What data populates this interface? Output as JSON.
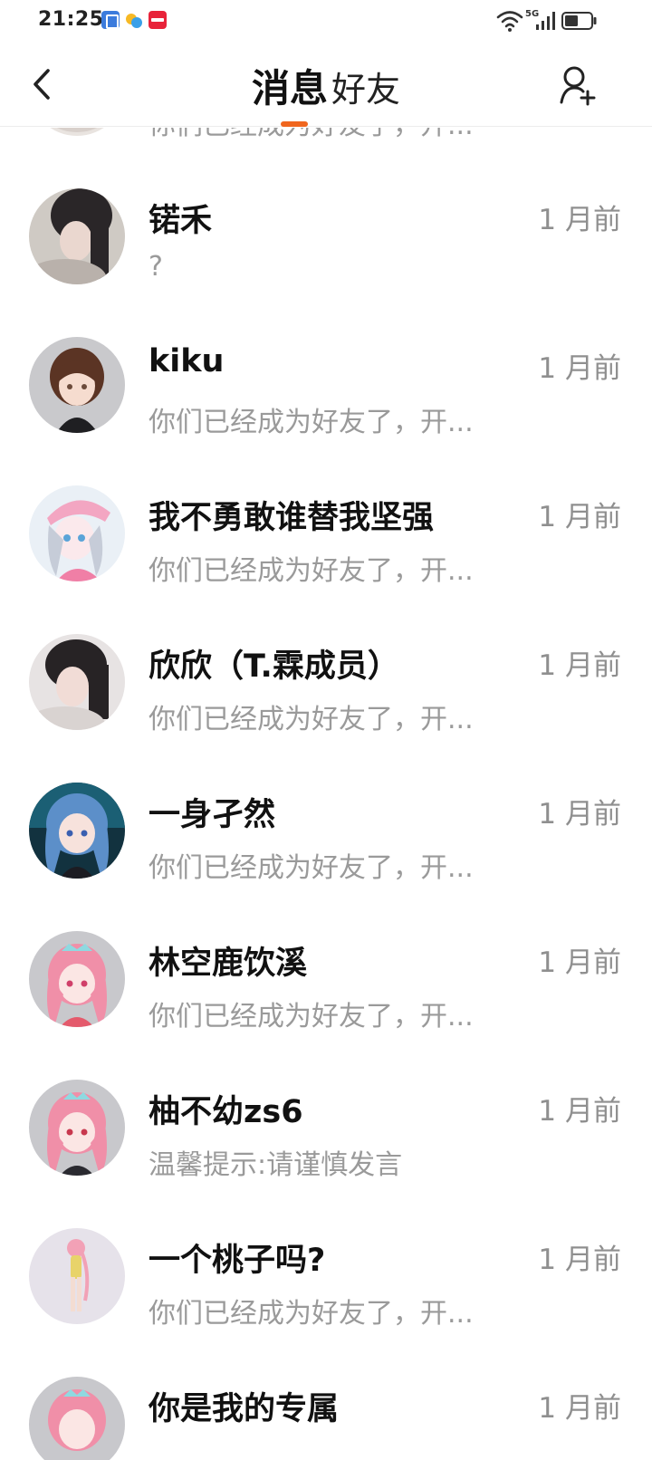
{
  "status_bar": {
    "time": "21:25",
    "network": "5G",
    "apps": [
      "contacts-app-icon",
      "weather-app-icon",
      "xiaohongshu-app-icon"
    ]
  },
  "header": {
    "tabs": [
      {
        "label": "消息",
        "active": true
      },
      {
        "label": "好友",
        "active": false
      }
    ],
    "accent_color": "#f0661e"
  },
  "conversations": [
    {
      "name": "",
      "time": "",
      "preview": "你们已经成为好友了，开...",
      "avatar": "photo-avatar"
    },
    {
      "name": "锘禾",
      "time": "1 月前",
      "preview": "?",
      "avatar": "photo-avatar"
    },
    {
      "name": "kiku",
      "time": "1 月前",
      "preview": "你们已经成为好友了，开...",
      "avatar": "anime-avatar"
    },
    {
      "name": "我不勇敢谁替我坚强",
      "time": "1 月前",
      "preview": "你们已经成为好友了，开...",
      "avatar": "anime-avatar"
    },
    {
      "name": "欣欣（T.霖成员）",
      "time": "1 月前",
      "preview": "你们已经成为好友了，开...",
      "avatar": "photo-avatar"
    },
    {
      "name": "一身孑然",
      "time": "1 月前",
      "preview": "你们已经成为好友了，开...",
      "avatar": "anime-avatar"
    },
    {
      "name": "林空鹿饮溪",
      "time": "1 月前",
      "preview": "你们已经成为好友了，开...",
      "avatar": "anime-avatar"
    },
    {
      "name": "柚不幼zs6",
      "time": "1 月前",
      "preview": "温馨提示:请谨慎发言",
      "avatar": "anime-avatar"
    },
    {
      "name": "一个桃子吗?",
      "time": "1 月前",
      "preview": "你们已经成为好友了，开...",
      "avatar": "anime-avatar"
    },
    {
      "name": "你是我的专属",
      "time": "1 月前",
      "preview": "",
      "avatar": "anime-avatar"
    }
  ]
}
